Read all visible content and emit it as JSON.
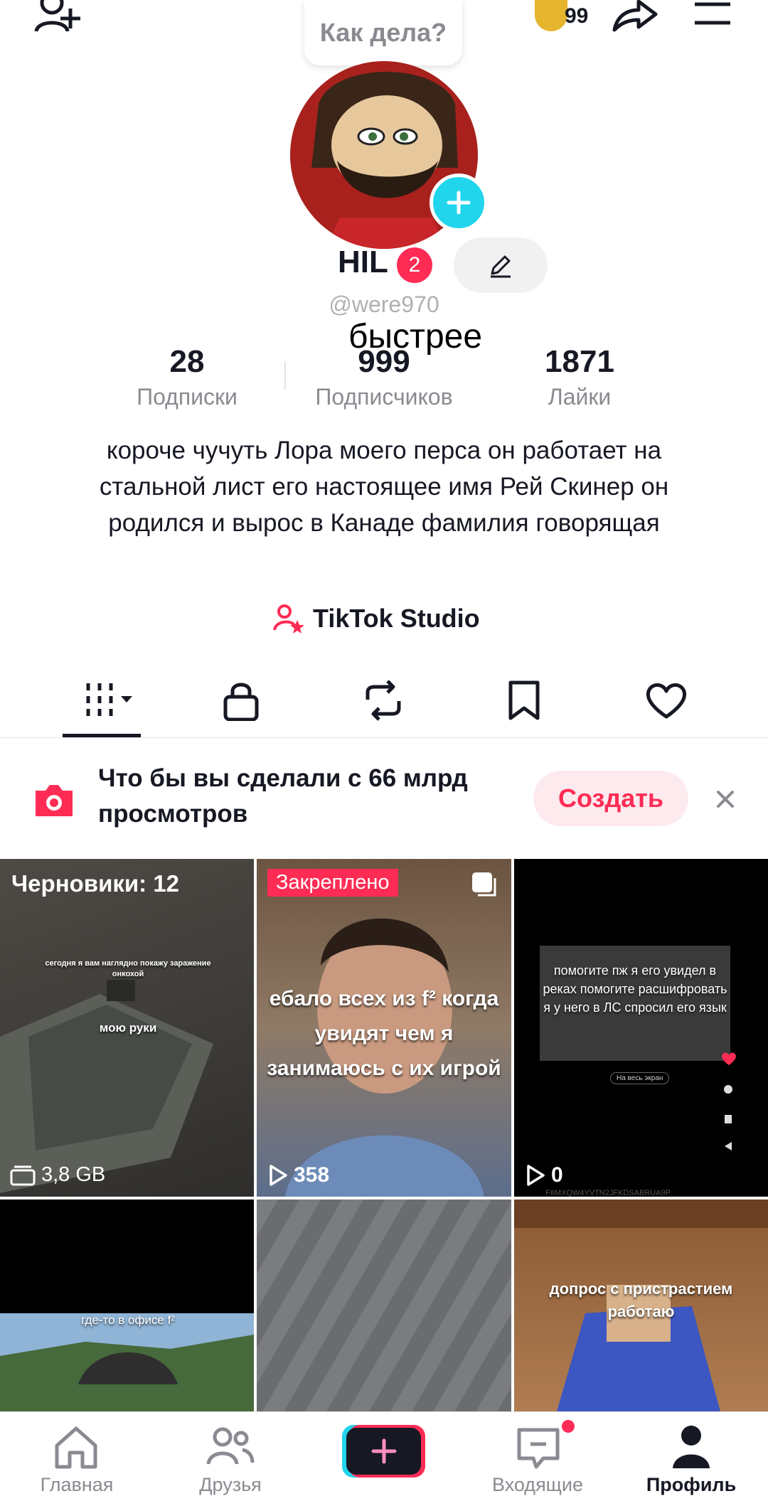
{
  "header": {
    "bubble_text": "Как дела?",
    "friends_count": "99"
  },
  "profile": {
    "name": "HIL",
    "notif_badge": "2",
    "handle": "@were970",
    "overlay_text": "быстрее",
    "stats": [
      {
        "value": "28",
        "label": "Подписки"
      },
      {
        "value": "999",
        "label": "Подписчиков"
      },
      {
        "value": "1871",
        "label": "Лайки"
      }
    ],
    "bio": "короче чучуть Лора моего перса он работает на стальной лист его настоящее имя Рей Скинер он родился и вырос в Канаде фамилия говорящая",
    "studio_label": "TikTok Studio"
  },
  "promo": {
    "text": "Что бы вы сделали с 66 млрд просмотров",
    "create_label": "Создать"
  },
  "grid": {
    "drafts_label": "Черновики: 12",
    "drafts_size": "3,8 GB",
    "drafts_caption_top": "сегодня я вам наглядно покажу заражение онкохой",
    "drafts_caption": "мою руки",
    "pinned_label": "Закреплено",
    "pinned_caption": "ебало всех из f² когда увидят чем я занимаюсь с их игрой",
    "pinned_views": "358",
    "third_caption": "помогите пж я его увидел в реках помогите расшифровать я у него в ЛС спросил его язык",
    "third_small": "На весь экран",
    "third_views": "0",
    "third_id": "F8MXQW4YVTN2JFKDSABRUA9P",
    "row2_left_caption": "где-то в офисе f²",
    "row2_right_caption": "допрос с пристрастием работаю"
  },
  "bottom_nav": [
    {
      "label": "Главная"
    },
    {
      "label": "Друзья"
    },
    {
      "label": ""
    },
    {
      "label": "Входящие"
    },
    {
      "label": "Профиль"
    }
  ],
  "colors": {
    "accent": "#fe2c55",
    "cyan": "#20d5ec"
  }
}
